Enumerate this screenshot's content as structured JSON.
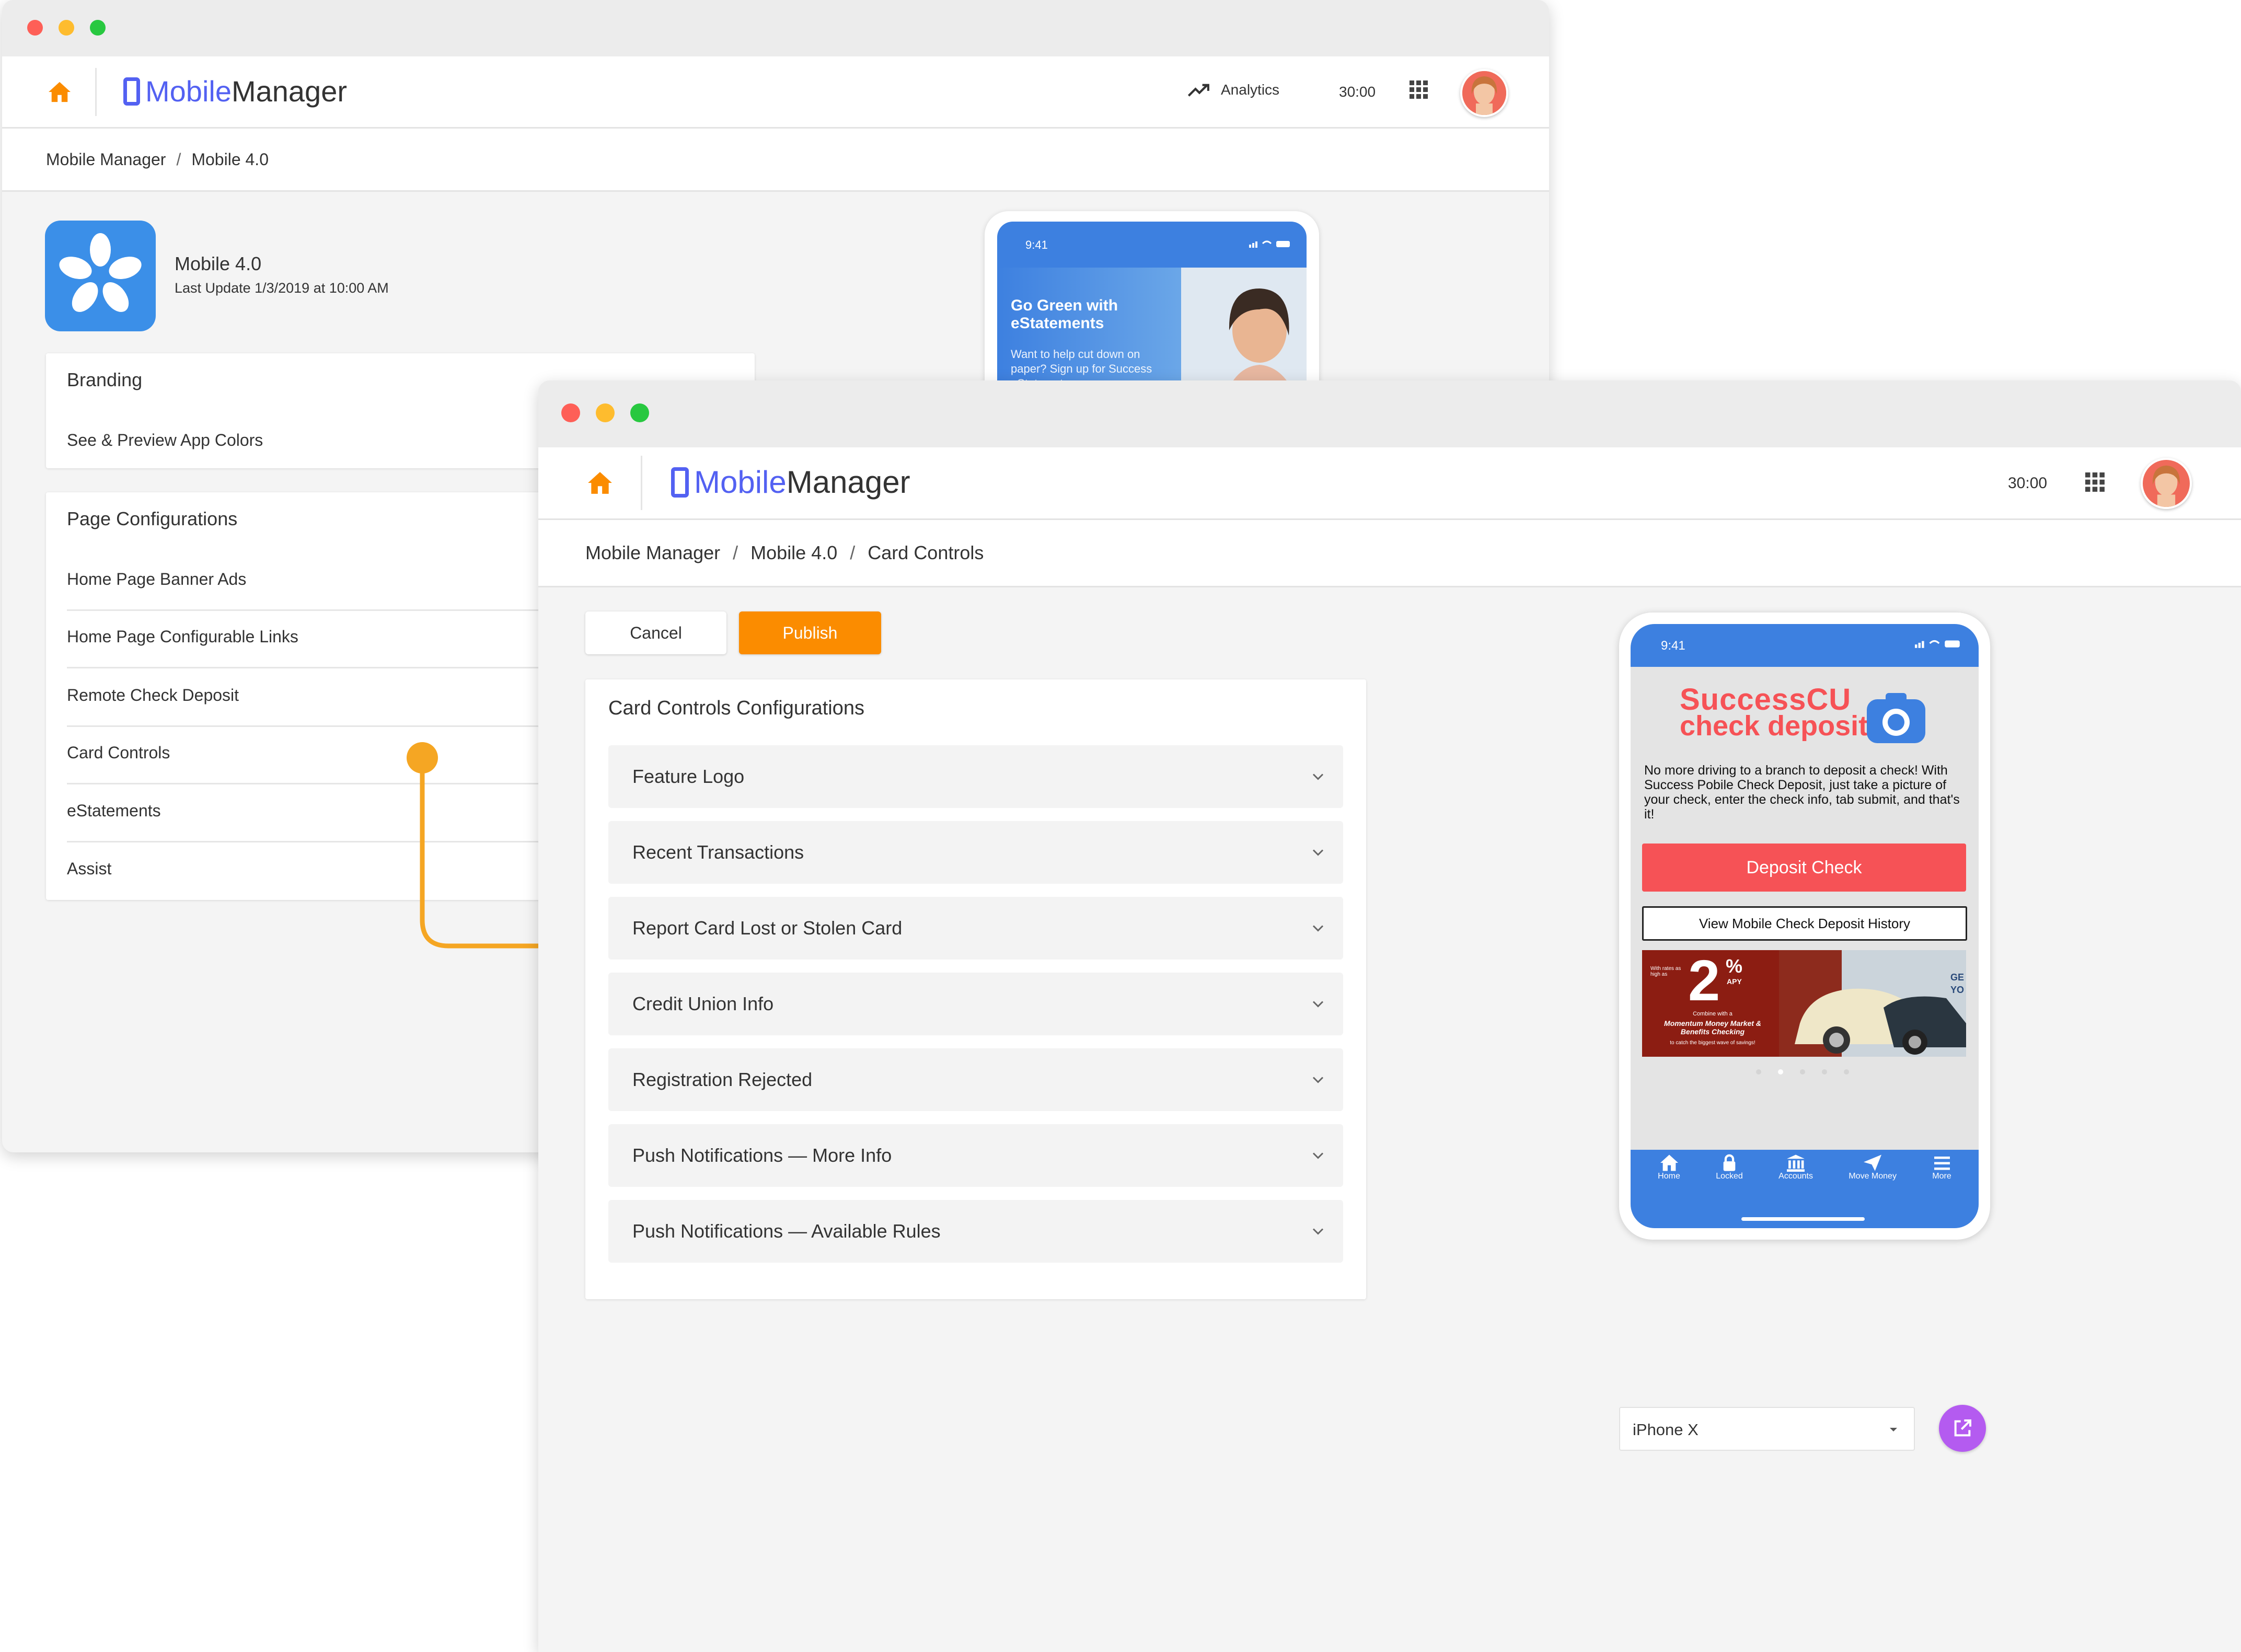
{
  "back_window": {
    "app_brand": {
      "part1": "Mobile",
      "part2": "Manager"
    },
    "analytics_label": "Analytics",
    "timer": "30:00",
    "breadcrumb": {
      "item1": "Mobile Manager",
      "sep": "/",
      "item2": "Mobile 4.0"
    },
    "app_info": {
      "name": "Mobile 4.0",
      "last_update": "Last Update 1/3/2019 at 10:00 AM"
    },
    "branding": {
      "title": "Branding",
      "item": "See & Preview App Colors"
    },
    "page_configurations": {
      "title": "Page Configurations",
      "items": [
        {
          "label": "Home Page Banner Ads"
        },
        {
          "label": "Home Page Configurable Links"
        },
        {
          "label": "Remote Check Deposit"
        },
        {
          "label": "Card Controls"
        },
        {
          "label": "eStatements"
        },
        {
          "label": "Assist"
        }
      ]
    },
    "phone_preview": {
      "time": "9:41",
      "banner_title": "Go Green with eStatements",
      "banner_text": "Want to help cut down on paper? Sign up for Success eStatments"
    }
  },
  "front_window": {
    "app_brand": {
      "part1": "Mobile",
      "part2": "Manager"
    },
    "timer": "30:00",
    "breadcrumb": {
      "item1": "Mobile Manager",
      "item2": "Mobile 4.0",
      "item3": "Card Controls",
      "sep": "/"
    },
    "buttons": {
      "cancel": "Cancel",
      "publish": "Publish"
    },
    "config_card": {
      "title": "Card Controls Configurations",
      "sections": [
        {
          "label": "Feature Logo"
        },
        {
          "label": "Recent Transactions"
        },
        {
          "label": "Report Card Lost or Stolen Card"
        },
        {
          "label": "Credit Union Info"
        },
        {
          "label": "Registration Rejected"
        },
        {
          "label": "Push Notifications — More Info"
        },
        {
          "label": "Push Notifications — Available Rules"
        }
      ]
    },
    "phone": {
      "time": "9:41",
      "logo_line1": "SuccessCU",
      "logo_line2": "check deposit",
      "description": "No more driving to a branch to deposit a check! With Success Pobile Check Deposit, just take a picture of your check, enter the check info, tab submit, and that's it!",
      "deposit_button": "Deposit Check",
      "history_button": "View Mobile Check Deposit History",
      "ad": {
        "rate": "2",
        "percent": "%",
        "apy": "APY",
        "small_lead": "With rates as high as",
        "combine": "Combine with a",
        "product": "Momentum Money Market & Benefits Checking",
        "tagline": "to catch the biggest wave of savings!",
        "side_text": "GE YO"
      },
      "tabs": [
        {
          "label": "Home",
          "icon": "home-icon"
        },
        {
          "label": "Locked",
          "icon": "lock-icon"
        },
        {
          "label": "Accounts",
          "icon": "bank-icon"
        },
        {
          "label": "Move Money",
          "icon": "send-icon"
        },
        {
          "label": "More",
          "icon": "menu-icon"
        }
      ]
    },
    "device_select": {
      "value": "iPhone X"
    }
  },
  "colors": {
    "accent_orange": "#fb8c00",
    "brand_blue": "#5361f2",
    "phone_blue": "#3d80e0",
    "deposit_red": "#f65256",
    "purple_fab": "#b45bf0",
    "arrow_orange": "#f5a623"
  }
}
